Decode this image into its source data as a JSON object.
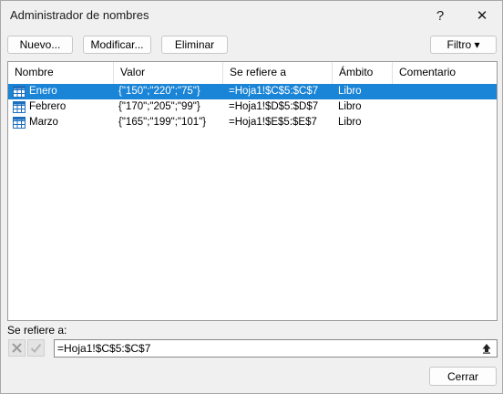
{
  "window": {
    "title": "Administrador de nombres",
    "help": "?",
    "close": "✕"
  },
  "toolbar": {
    "new": "Nuevo...",
    "edit": "Modificar...",
    "delete": "Eliminar",
    "filter": "Filtro ▾"
  },
  "columns": [
    "Nombre",
    "Valor",
    "Se refiere a",
    "Ámbito",
    "Comentario"
  ],
  "rows": [
    {
      "name": "Enero",
      "value": "{\"150\";\"220\";\"75\"}",
      "ref": "=Hoja1!$C$5:$C$7",
      "scope": "Libro",
      "comment": "",
      "selected": true
    },
    {
      "name": "Febrero",
      "value": "{\"170\";\"205\";\"99\"}",
      "ref": "=Hoja1!$D$5:$D$7",
      "scope": "Libro",
      "comment": ""
    },
    {
      "name": "Marzo",
      "value": "{\"165\";\"199\";\"101\"}",
      "ref": "=Hoja1!$E$5:$E$7",
      "scope": "Libro",
      "comment": ""
    }
  ],
  "refers_to": {
    "label": "Se refiere a:",
    "value": "=Hoja1!$C$5:$C$7"
  },
  "footer": {
    "close": "Cerrar"
  },
  "colors": {
    "selection": "#1a84d6",
    "table_icon": "#1f6fbf"
  }
}
